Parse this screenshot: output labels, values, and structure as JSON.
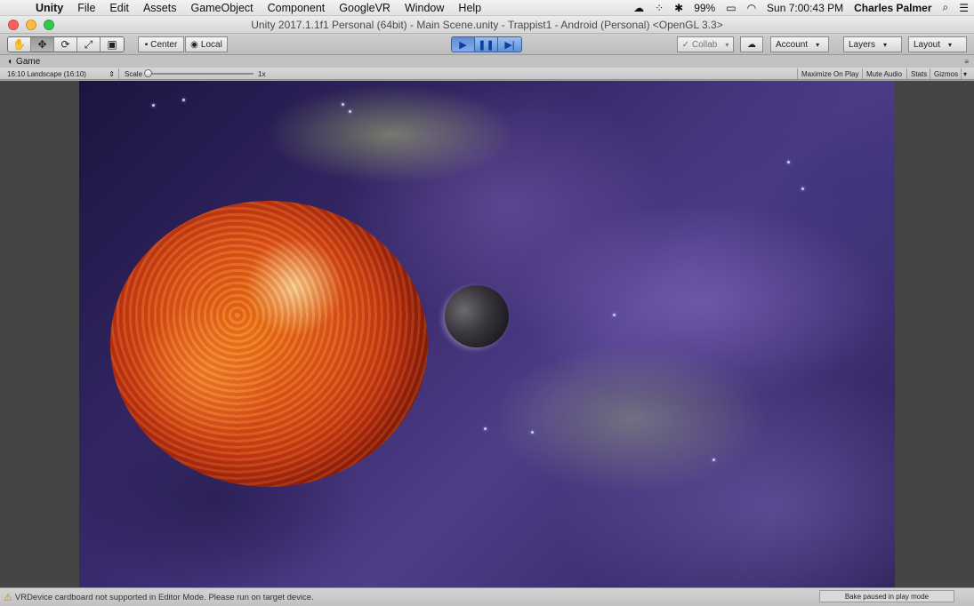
{
  "menubar": {
    "app_name": "Unity",
    "items": [
      "File",
      "Edit",
      "Assets",
      "GameObject",
      "Component",
      "GoogleVR",
      "Window",
      "Help"
    ],
    "battery": "99%",
    "clock": "Sun 7:00:43 PM",
    "user": "Charles Palmer"
  },
  "window": {
    "title": "Unity 2017.1.1f1 Personal (64bit) - Main Scene.unity - Trappist1 - Android (Personal) <OpenGL 3.3>"
  },
  "toolbar": {
    "tools": [
      "hand-tool-icon",
      "move-tool-icon",
      "rotate-tool-icon",
      "scale-tool-icon",
      "rect-tool-icon"
    ],
    "pivot_label": "Center",
    "space_label": "Local",
    "collab_label": "Collab",
    "account_label": "Account",
    "layers_label": "Layers",
    "layout_label": "Layout",
    "play_controls": [
      "play",
      "pause",
      "step"
    ]
  },
  "game_panel": {
    "tab_label": "Game",
    "aspect": "16:10 Landscape (16:10)",
    "scale_label": "Scale",
    "scale_value": "1x",
    "toggles": [
      "Maximize On Play",
      "Mute Audio",
      "Stats",
      "Gizmos"
    ]
  },
  "status": {
    "message": "VRDevice cardboard not supported in Editor Mode.  Please run on target device.",
    "bake_label": "Bake paused in play mode"
  }
}
